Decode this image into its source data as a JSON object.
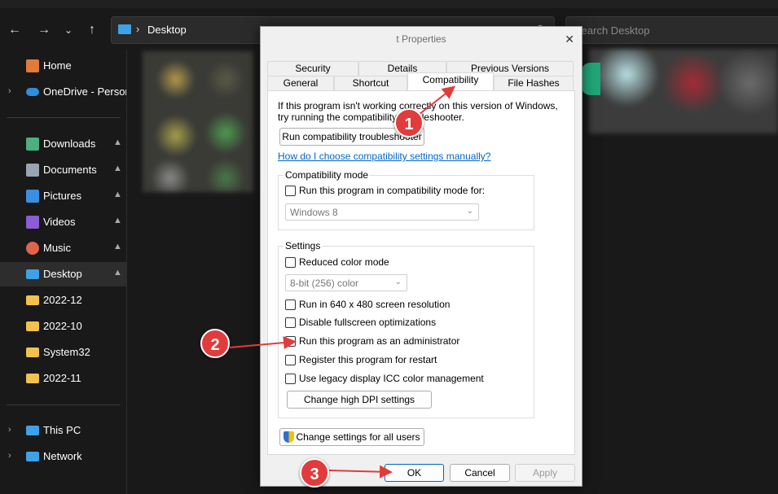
{
  "explorer": {
    "address": {
      "crumb": "Desktop"
    },
    "search_placeholder": "Search Desktop",
    "sidebar": [
      {
        "label": "Home",
        "icon": "home-icon",
        "color": "#e07b39"
      },
      {
        "label": "OneDrive - Persona",
        "icon": "onedrive-icon",
        "color": "#2f8ee0"
      },
      {
        "label": "Downloads",
        "icon": "downloads-icon",
        "color": "#4caf7d",
        "pinned": true
      },
      {
        "label": "Documents",
        "icon": "documents-icon",
        "color": "#9aa4b0",
        "pinned": true
      },
      {
        "label": "Pictures",
        "icon": "pictures-icon",
        "color": "#3b8fe0",
        "pinned": true
      },
      {
        "label": "Videos",
        "icon": "videos-icon",
        "color": "#8b5cd6",
        "pinned": true
      },
      {
        "label": "Music",
        "icon": "music-icon",
        "color": "#e0644b",
        "pinned": true
      },
      {
        "label": "Desktop",
        "icon": "desktop-icon",
        "color": "#3fa1e6",
        "pinned": true,
        "active": true
      },
      {
        "label": "2022-12",
        "icon": "folder-icon",
        "color": "#f2c14e"
      },
      {
        "label": "2022-10",
        "icon": "folder-icon",
        "color": "#f2c14e"
      },
      {
        "label": "System32",
        "icon": "folder-icon",
        "color": "#f2c14e"
      },
      {
        "label": "2022-11",
        "icon": "folder-icon",
        "color": "#f2c14e"
      },
      {
        "label": "This PC",
        "icon": "this-pc-icon",
        "color": "#3fa1e6"
      },
      {
        "label": "Network",
        "icon": "network-icon",
        "color": "#3fa1e6"
      }
    ]
  },
  "dialog": {
    "title": "t Properties",
    "tabs_row1": [
      "Security",
      "Details",
      "Previous Versions"
    ],
    "tabs_row2": [
      "General",
      "Shortcut",
      "Compatibility",
      "File Hashes"
    ],
    "intro_line1": "If this program isn't working correctly on this version of Windows,",
    "intro_line2": "try running the compatibility troubleshooter.",
    "run_troubleshooter": "Run compatibility troubleshooter",
    "help_link": "How do I choose compatibility settings manually?",
    "compat_mode": {
      "legend": "Compatibility mode",
      "checkbox": "Run this program in compatibility mode for:",
      "select_value": "Windows 8"
    },
    "settings": {
      "legend": "Settings",
      "reduced_color": "Reduced color mode",
      "color_select": "8-bit (256) color",
      "res_640": "Run in 640 x 480 screen resolution",
      "disable_fullscreen": "Disable fullscreen optimizations",
      "run_admin": "Run this program as an administrator",
      "register_restart": "Register this program for restart",
      "legacy_icc": "Use legacy display ICC color management",
      "dpi_button": "Change high DPI settings"
    },
    "all_users_button": "Change settings for all users",
    "ok": "OK",
    "cancel": "Cancel",
    "apply": "Apply"
  },
  "annotations": [
    "1",
    "2",
    "3"
  ]
}
